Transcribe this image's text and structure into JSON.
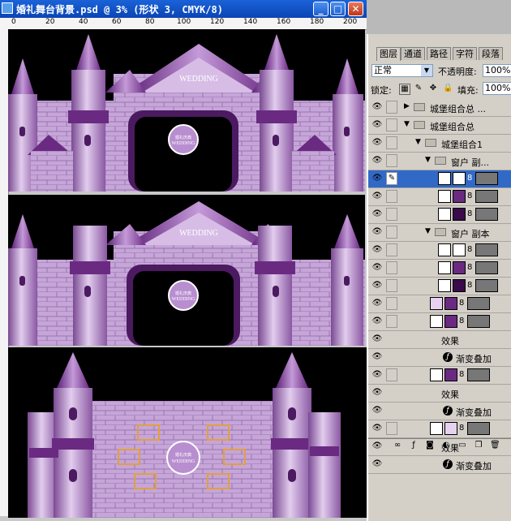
{
  "window": {
    "title": "婚礼舞台背景.psd @ 3% (形状 3, CMYK/8)",
    "minimize_label": "_",
    "maximize_label": "□",
    "close_label": "✕"
  },
  "ruler": {
    "ticks": [
      "0",
      "20",
      "40",
      "60",
      "80",
      "100",
      "120",
      "140",
      "160",
      "180",
      "200"
    ]
  },
  "artwork": {
    "banner_text": "WEDDING",
    "emblem_text": "WEDDING",
    "emblem_small": "婚礼庆典",
    "colors": {
      "lilac": "#c9a9dc",
      "deep_purple": "#6a2a82",
      "brick": "#b893cc",
      "frame_orange": "#e0a040",
      "background": "#000000"
    }
  },
  "panel": {
    "tabs": [
      "图层",
      "通道",
      "路径",
      "字符",
      "段落"
    ],
    "active_tab": "图层",
    "blend_mode": "正常",
    "opacity_label": "不透明度:",
    "opacity_value": "100%",
    "lock_label": "锁定:",
    "fill_label": "填充:",
    "fill_value": "100%",
    "layers": [
      {
        "type": "group",
        "collapsed": true,
        "name": "城堡组合总 ..."
      },
      {
        "type": "group",
        "collapsed": false,
        "name": "城堡组合总"
      },
      {
        "type": "group",
        "collapsed": false,
        "name": "城堡组合1"
      },
      {
        "type": "group",
        "collapsed": false,
        "name": "窗户 副..."
      },
      {
        "type": "layer",
        "selected": true
      },
      {
        "type": "layer"
      },
      {
        "type": "layer"
      },
      {
        "type": "group",
        "collapsed": false,
        "name": "窗户 副本"
      },
      {
        "type": "layer"
      },
      {
        "type": "layer"
      },
      {
        "type": "layer"
      },
      {
        "type": "layer"
      },
      {
        "type": "layer"
      },
      {
        "type": "effects_header",
        "name": "效果"
      },
      {
        "type": "effect",
        "name": "渐变叠加"
      },
      {
        "type": "layer"
      },
      {
        "type": "effects_header",
        "name": "效果"
      },
      {
        "type": "effect",
        "name": "渐变叠加"
      },
      {
        "type": "layer"
      },
      {
        "type": "effects_header",
        "name": "效果"
      },
      {
        "type": "effect",
        "name": "渐变叠加"
      }
    ]
  }
}
